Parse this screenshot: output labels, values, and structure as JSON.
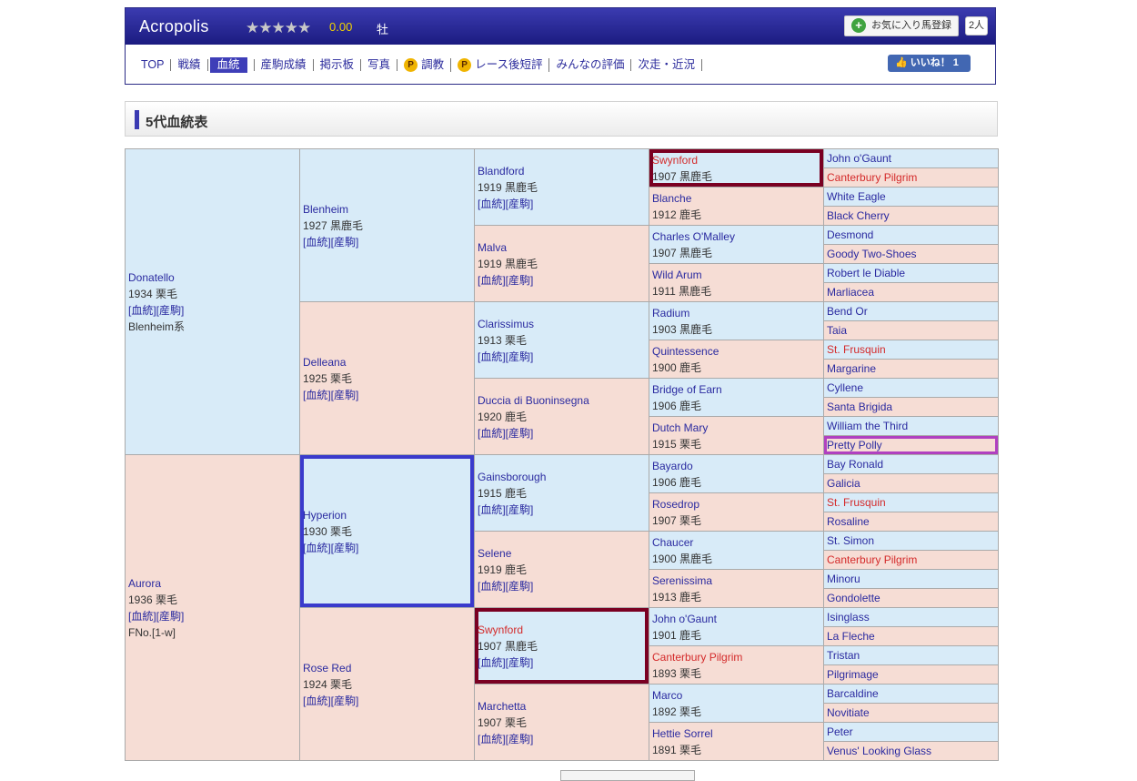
{
  "header": {
    "horse_name": "Acropolis",
    "stars": "★★★★★",
    "score": "0.00",
    "sex": "牡",
    "favorite_label": "お気に入り馬登録",
    "favorite_icon_glyph": "+",
    "favorite_count": "2人",
    "like_label": "いいね！ 1",
    "like_icon_glyph": "👍",
    "colors": {
      "header_bg": "#2b2b90",
      "score": "#f2d200",
      "active_tab": "#3e3eb8",
      "like_bg": "#4267b2"
    }
  },
  "nav": {
    "items": [
      {
        "label": "TOP"
      },
      {
        "label": "戦績"
      },
      {
        "label": "血統"
      },
      {
        "label": "産駒成績"
      },
      {
        "label": "掲示板"
      },
      {
        "label": "写真"
      },
      {
        "label": "調教",
        "badge": "P"
      },
      {
        "label": "レース後短評",
        "badge": "P"
      },
      {
        "label": "みんなの評価"
      },
      {
        "label": "次走・近況"
      }
    ],
    "active": "血統"
  },
  "section": {
    "title": "5代血統表"
  },
  "pedigree": {
    "link_label": "[血統][産駒]",
    "g1": [
      {
        "name": "Donatello",
        "info": "1934 栗毛",
        "system": "Blenheim系"
      },
      {
        "name": "Aurora",
        "info": "1936 栗毛",
        "system": "FNo.[1-w]"
      }
    ],
    "g2": [
      {
        "name": "Blenheim",
        "info": "1927 黒鹿毛"
      },
      {
        "name": "Delleana",
        "info": "1925 栗毛"
      },
      {
        "name": "Hyperion",
        "info": "1930 栗毛"
      },
      {
        "name": "Rose Red",
        "info": "1924 栗毛"
      }
    ],
    "g3": [
      {
        "name": "Blandford",
        "info": "1919 黒鹿毛"
      },
      {
        "name": "Malva",
        "info": "1919 黒鹿毛"
      },
      {
        "name": "Clarissimus",
        "info": "1913 栗毛"
      },
      {
        "name": "Duccia di Buoninsegna",
        "info": "1920 鹿毛"
      },
      {
        "name": "Gainsborough",
        "info": "1915 鹿毛"
      },
      {
        "name": "Selene",
        "info": "1919 鹿毛"
      },
      {
        "name": "Swynford",
        "info": "1907 黒鹿毛"
      },
      {
        "name": "Marchetta",
        "info": "1907 栗毛"
      }
    ],
    "g4": [
      {
        "name": "Swynford",
        "info": "1907 黒鹿毛"
      },
      {
        "name": "Blanche",
        "info": "1912 鹿毛"
      },
      {
        "name": "Charles O'Malley",
        "info": "1907 黒鹿毛"
      },
      {
        "name": "Wild Arum",
        "info": "1911 黒鹿毛"
      },
      {
        "name": "Radium",
        "info": "1903 黒鹿毛"
      },
      {
        "name": "Quintessence",
        "info": "1900 鹿毛"
      },
      {
        "name": "Bridge of Earn",
        "info": "1906 鹿毛"
      },
      {
        "name": "Dutch Mary",
        "info": "1915 栗毛"
      },
      {
        "name": "Bayardo",
        "info": "1906 鹿毛"
      },
      {
        "name": "Rosedrop",
        "info": "1907 栗毛"
      },
      {
        "name": "Chaucer",
        "info": "1900 黒鹿毛"
      },
      {
        "name": "Serenissima",
        "info": "1913 鹿毛"
      },
      {
        "name": "John o'Gaunt",
        "info": "1901 鹿毛"
      },
      {
        "name": "Canterbury Pilgrim",
        "info": "1893 栗毛"
      },
      {
        "name": "Marco",
        "info": "1892 栗毛"
      },
      {
        "name": "Hettie Sorrel",
        "info": "1891 栗毛"
      }
    ],
    "g5": [
      "John o'Gaunt",
      "Canterbury Pilgrim",
      "White Eagle",
      "Black Cherry",
      "Desmond",
      "Goody Two-Shoes",
      "Robert le Diable",
      "Marliacea",
      "Bend Or",
      "Taia",
      "St. Frusquin",
      "Margarine",
      "Cyllene",
      "Santa Brigida",
      "William the Third",
      "Pretty Polly",
      "Bay Ronald",
      "Galicia",
      "St. Frusquin",
      "Rosaline",
      "St. Simon",
      "Canterbury Pilgrim",
      "Minoru",
      "Gondolette",
      "Isinglass",
      "La Fleche",
      "Tristan",
      "Pilgrimage",
      "Barcaldine",
      "Novitiate",
      "Peter",
      "Venus' Looking Glass"
    ]
  }
}
